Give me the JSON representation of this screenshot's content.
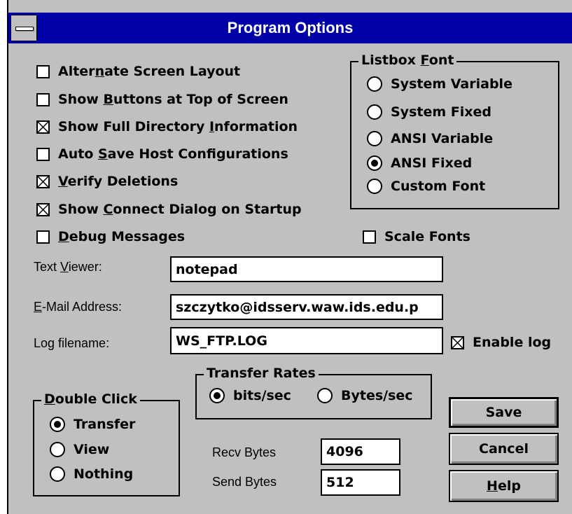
{
  "window": {
    "title": "Program Options"
  },
  "options": [
    {
      "pre": "Alter",
      "key": "n",
      "post": "ate Screen Layout",
      "checked": false
    },
    {
      "pre": "Show ",
      "key": "B",
      "post": "uttons at Top of Screen",
      "checked": false
    },
    {
      "pre": "Show Full Directory ",
      "key": "I",
      "post": "nformation",
      "checked": true
    },
    {
      "pre": "Auto ",
      "key": "S",
      "post": "ave Host Configurations",
      "checked": false
    },
    {
      "pre": "",
      "key": "V",
      "post": "erify Deletions",
      "checked": true
    },
    {
      "pre": "Show ",
      "key": "C",
      "post": "onnect Dialog on Startup",
      "checked": true
    },
    {
      "pre": "",
      "key": "D",
      "post": "ebug Messages",
      "checked": false
    }
  ],
  "listbox_font": {
    "legend_pre": "Listbox ",
    "legend_key": "F",
    "legend_post": "ont",
    "choices": [
      "System Variable",
      "System Fixed",
      "ANSI Variable",
      "ANSI Fixed",
      "Custom Font"
    ],
    "selected": "ANSI Fixed"
  },
  "scale_fonts": {
    "label": "Scale Fonts",
    "checked": false
  },
  "text_viewer": {
    "label_pre": "Text ",
    "label_key": "V",
    "label_post": "iewer:",
    "value": "notepad"
  },
  "email": {
    "label_pre": "",
    "label_key": "E",
    "label_post": "-Mail Address:",
    "value": "szczytko@idsserv.waw.ids.edu.p"
  },
  "log": {
    "label": "Log filename:",
    "value": "WS_FTP.LOG",
    "enable_label": "Enable log",
    "enabled": true
  },
  "double_click": {
    "legend_pre": "",
    "legend_key": "D",
    "legend_post": "ouble Click",
    "choices": [
      "Transfer",
      "View",
      "Nothing"
    ],
    "selected": "Transfer"
  },
  "transfer_rates": {
    "legend": "Transfer Rates",
    "choices": [
      "bits/sec",
      "Bytes/sec"
    ],
    "selected": "bits/sec"
  },
  "recv_bytes": {
    "label": "Recv Bytes",
    "value": "4096"
  },
  "send_bytes": {
    "label": "Send Bytes",
    "value": "512"
  },
  "buttons": {
    "save": "Save",
    "cancel": "Cancel",
    "help_key": "H",
    "help_post": "elp"
  }
}
